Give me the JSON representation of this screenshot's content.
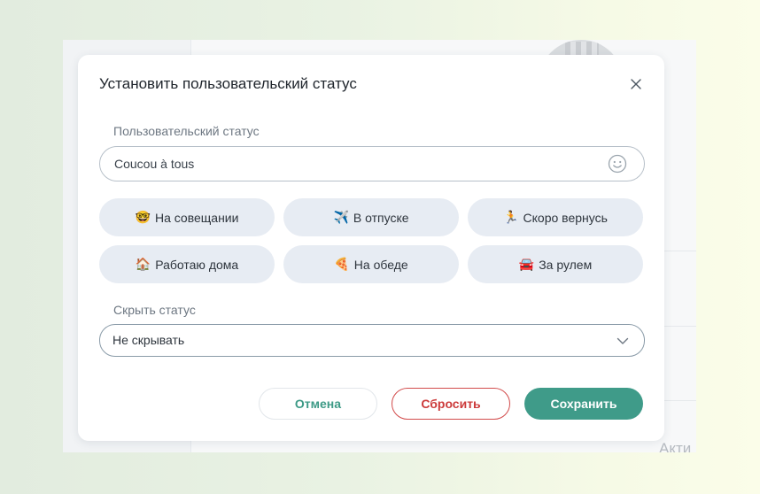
{
  "background": {
    "partial_text": "Акти"
  },
  "dialog": {
    "title": "Установить пользовательский статус",
    "close_icon": "close-icon"
  },
  "status_field": {
    "label": "Пользовательский статус",
    "value": "Coucou à tous",
    "emoji_icon": "smiley-icon"
  },
  "presets": [
    {
      "icon": "🤓",
      "label": "На совещании"
    },
    {
      "icon": "✈️",
      "label": "В отпуске"
    },
    {
      "icon": "🏃",
      "label": "Скоро вернусь"
    },
    {
      "icon": "🏠",
      "label": "Работаю дома"
    },
    {
      "icon": "🍕",
      "label": "На обеде"
    },
    {
      "icon": "🚘",
      "label": "За рулем"
    }
  ],
  "hide_field": {
    "label": "Скрыть статус",
    "value": "Не скрывать",
    "chevron_icon": "chevron-down-icon"
  },
  "actions": {
    "cancel": "Отмена",
    "reset": "Сбросить",
    "save": "Сохранить"
  },
  "colors": {
    "accent": "#3f9b89",
    "danger": "#cc3b3b",
    "chip_bg": "#e7ecf3"
  }
}
